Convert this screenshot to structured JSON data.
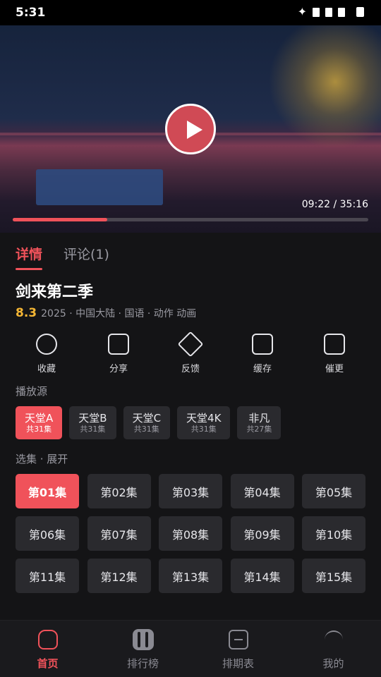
{
  "status_bar": {
    "time": "5:31"
  },
  "player": {
    "time_label": "09:22 / 35:16",
    "progress_fraction": 0.266,
    "accent": "#f0525a"
  },
  "tabs": [
    {
      "label": "详情",
      "active": true
    },
    {
      "label": "评论(1)",
      "active": false
    }
  ],
  "show": {
    "title": "剑来第二季",
    "score": "8.3",
    "meta": "2025 · 中国大陆 · 国语 · 动作 动画"
  },
  "actions": [
    {
      "label": "收藏",
      "icon": "heart-icon"
    },
    {
      "label": "分享",
      "icon": "share-icon"
    },
    {
      "label": "反馈",
      "icon": "feedback-icon"
    },
    {
      "label": "缓存",
      "icon": "download-icon"
    },
    {
      "label": "催更",
      "icon": "bell-icon"
    }
  ],
  "sources_label": "播放源",
  "sources": [
    {
      "name": "天堂A",
      "count": "共31集",
      "active": true
    },
    {
      "name": "天堂B",
      "count": "共31集",
      "active": false
    },
    {
      "name": "天堂C",
      "count": "共31集",
      "active": false
    },
    {
      "name": "天堂4K",
      "count": "共31集",
      "active": false
    },
    {
      "name": "非凡",
      "count": "共27集",
      "active": false
    }
  ],
  "episodes_label": "选集 · 展开",
  "episodes": [
    "第01集",
    "第02集",
    "第03集",
    "第04集",
    "第05集",
    "第06集",
    "第07集",
    "第08集",
    "第09集",
    "第10集",
    "第11集",
    "第12集",
    "第13集",
    "第14集",
    "第15集"
  ],
  "active_episode": 0,
  "nav": [
    {
      "label": "首页",
      "icon": "home-icon",
      "active": true
    },
    {
      "label": "排行榜",
      "icon": "ranking-icon",
      "active": false
    },
    {
      "label": "排期表",
      "icon": "schedule-icon",
      "active": false
    },
    {
      "label": "我的",
      "icon": "profile-icon",
      "active": false
    }
  ]
}
